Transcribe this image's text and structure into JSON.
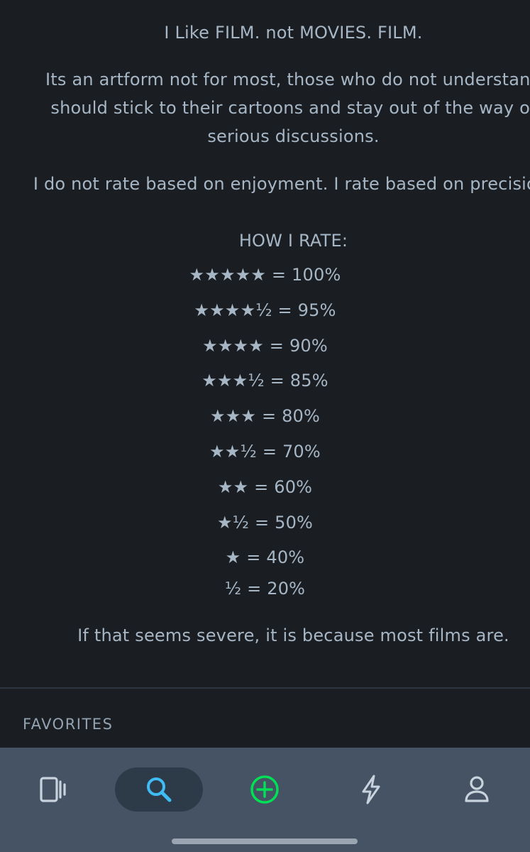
{
  "bio": {
    "line1": "I Like FILM. not MOVIES. FILM.",
    "paragraph2": "Its an artform not for most, those who do not understand should stick to their cartoons and stay out of the way of serious discussions.",
    "paragraph3": "I do not rate based on enjoyment. I rate based on precision.",
    "rate_heading": "HOW I RATE:",
    "ratings": [
      "★★★★★ = 100%",
      "★★★★½ = 95%",
      "★★★★ = 90%",
      "★★★½ = 85%",
      "★★★ = 80%",
      "★★½ = 70%",
      "★★ = 60%",
      "★½ = 50%",
      "★ = 40%",
      "½ = 20%"
    ],
    "closing": "If that seems severe, it is because most films are."
  },
  "sections": {
    "favorites_label": "FAVORITES"
  },
  "nav": {
    "items": [
      {
        "icon": "films-icon",
        "active": false
      },
      {
        "icon": "search-icon",
        "active": true
      },
      {
        "icon": "add-circle-icon",
        "active": false
      },
      {
        "icon": "activity-bolt-icon",
        "active": false
      },
      {
        "icon": "profile-icon",
        "active": false
      }
    ],
    "colors": {
      "background": "#455364",
      "active_pill": "#2d3a48",
      "search_accent": "#40bcf4",
      "add_accent": "#00e054",
      "icon_default": "#c9d3de"
    }
  },
  "theme": {
    "page_background": "#1a1e23",
    "text": "#a7b6c5"
  }
}
